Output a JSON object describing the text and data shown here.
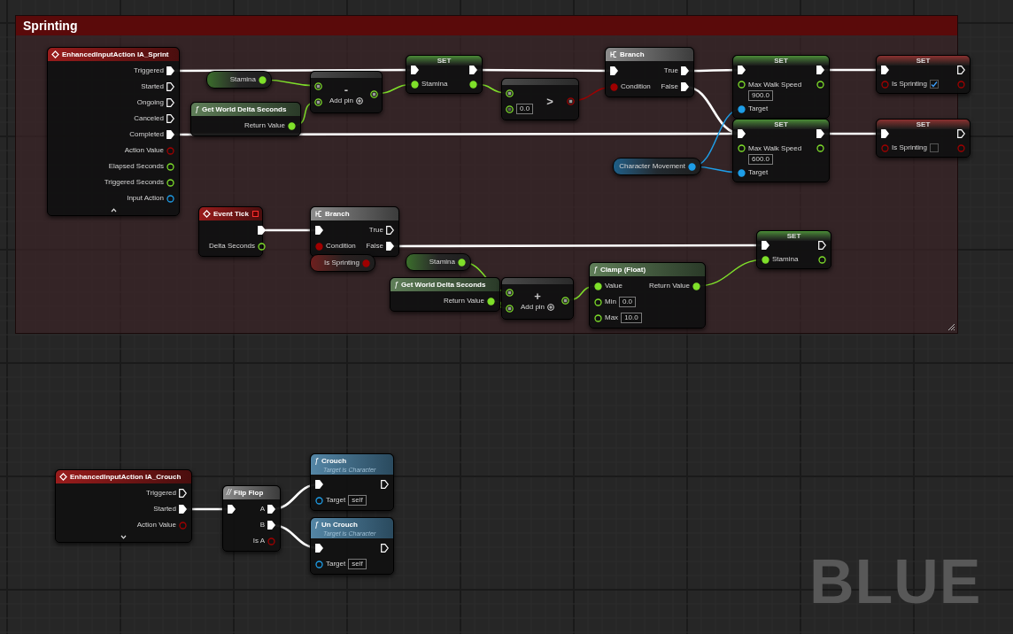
{
  "comment": {
    "title": "Sprinting"
  },
  "nodes": [
    {
      "kind": "event",
      "title": "EnhancedInputAction IA_Sprint",
      "outputs": [
        {
          "label": "Triggered",
          "kind": "exec",
          "linked": true
        },
        {
          "label": "Started",
          "kind": "exec",
          "linked": false
        },
        {
          "label": "Ongoing",
          "kind": "exec",
          "linked": false
        },
        {
          "label": "Canceled",
          "kind": "exec",
          "linked": false
        },
        {
          "label": "Completed",
          "kind": "exec",
          "linked": true
        },
        {
          "label": "Action Value",
          "kind": "bool",
          "linked": false
        },
        {
          "label": "Elapsed Seconds",
          "kind": "float",
          "linked": false
        },
        {
          "label": "Triggered Seconds",
          "kind": "float",
          "linked": false
        },
        {
          "label": "Input Action",
          "kind": "object",
          "linked": false
        }
      ],
      "expanded": true
    },
    {
      "kind": "variable",
      "title": "Stamina",
      "outputs": [
        {
          "kind": "float",
          "linked": true
        }
      ]
    },
    {
      "kind": "pure",
      "glyph": "ƒ",
      "title": "Get World Delta Seconds",
      "outputs": [
        {
          "label": "Return Value",
          "kind": "float",
          "linked": true
        }
      ]
    },
    {
      "kind": "operator",
      "symbol": "-",
      "add_pin": "Add pin",
      "inputs": [
        {
          "kind": "float",
          "linked": true
        },
        {
          "kind": "float",
          "linked": true
        }
      ],
      "outputs": [
        {
          "kind": "float",
          "linked": true
        }
      ]
    },
    {
      "kind": "set",
      "title": "SET",
      "inputs": [
        {
          "kind": "exec",
          "linked": true
        },
        {
          "label": "Stamina",
          "kind": "float",
          "linked": true
        }
      ],
      "outputs": [
        {
          "kind": "exec",
          "linked": true
        },
        {
          "kind": "float",
          "linked": true
        }
      ]
    },
    {
      "kind": "operator",
      "symbol": ">",
      "inputs": [
        {
          "kind": "float",
          "linked": true
        },
        {
          "kind": "float",
          "linked": false,
          "value": "0.0"
        }
      ],
      "outputs": [
        {
          "kind": "bool",
          "linked": true
        }
      ]
    },
    {
      "kind": "branch",
      "title": "Branch",
      "inputs": [
        {
          "kind": "exec",
          "linked": true
        },
        {
          "label": "Condition",
          "kind": "bool",
          "linked": true
        }
      ],
      "outputs": [
        {
          "label": "True",
          "kind": "exec",
          "linked": true
        },
        {
          "label": "False",
          "kind": "exec",
          "linked": true
        }
      ]
    },
    {
      "kind": "set",
      "title": "SET",
      "inputs": [
        {
          "kind": "exec",
          "linked": true
        },
        {
          "label": "Max Walk Speed",
          "kind": "float",
          "linked": false,
          "value": "900.0"
        },
        {
          "label": "Target",
          "kind": "object",
          "linked": true
        }
      ],
      "outputs": [
        {
          "kind": "exec",
          "linked": true
        },
        {
          "kind": "float",
          "linked": false
        }
      ]
    },
    {
      "kind": "set",
      "title": "SET",
      "inputs": [
        {
          "kind": "exec",
          "linked": true
        },
        {
          "label": "Max Walk Speed",
          "kind": "float",
          "linked": false,
          "value": "600.0"
        },
        {
          "label": "Target",
          "kind": "object",
          "linked": true
        }
      ],
      "outputs": [
        {
          "kind": "exec",
          "linked": true
        },
        {
          "kind": "float",
          "linked": false
        }
      ]
    },
    {
      "kind": "variable",
      "title": "Character Movement",
      "outputs": [
        {
          "kind": "object",
          "linked": true
        }
      ]
    },
    {
      "kind": "set",
      "title": "SET",
      "inputs": [
        {
          "kind": "exec",
          "linked": true
        },
        {
          "label": "Is Sprinting",
          "kind": "bool",
          "linked": false,
          "checked": true
        }
      ],
      "outputs": [
        {
          "kind": "exec",
          "linked": false
        },
        {
          "kind": "bool",
          "linked": false
        }
      ]
    },
    {
      "kind": "set",
      "title": "SET",
      "inputs": [
        {
          "kind": "exec",
          "linked": true
        },
        {
          "label": "Is Sprinting",
          "kind": "bool",
          "linked": false,
          "checked": false
        }
      ],
      "outputs": [
        {
          "kind": "exec",
          "linked": false
        },
        {
          "kind": "bool",
          "linked": false
        }
      ]
    },
    {
      "kind": "event",
      "title": "Event Tick",
      "delegate": true,
      "outputs": [
        {
          "kind": "exec",
          "linked": true
        },
        {
          "label": "Delta Seconds",
          "kind": "float",
          "linked": false
        }
      ]
    },
    {
      "kind": "branch",
      "title": "Branch",
      "inputs": [
        {
          "kind": "exec",
          "linked": true
        },
        {
          "label": "Condition",
          "kind": "bool",
          "linked": true
        }
      ],
      "outputs": [
        {
          "label": "True",
          "kind": "exec",
          "linked": false
        },
        {
          "label": "False",
          "kind": "exec",
          "linked": true
        }
      ]
    },
    {
      "kind": "variable",
      "title": "Is Sprinting",
      "outputs": [
        {
          "kind": "bool",
          "linked": true
        }
      ]
    },
    {
      "kind": "variable",
      "title": "Stamina",
      "outputs": [
        {
          "kind": "float",
          "linked": true
        }
      ]
    },
    {
      "kind": "pure",
      "glyph": "ƒ",
      "title": "Get World Delta Seconds",
      "outputs": [
        {
          "label": "Return Value",
          "kind": "float",
          "linked": true
        }
      ]
    },
    {
      "kind": "operator",
      "symbol": "+",
      "add_pin": "Add pin",
      "inputs": [
        {
          "kind": "float",
          "linked": true
        },
        {
          "kind": "float",
          "linked": true
        }
      ],
      "outputs": [
        {
          "kind": "float",
          "linked": true
        }
      ]
    },
    {
      "kind": "pure",
      "glyph": "ƒ",
      "title": "Clamp (Float)",
      "inputs": [
        {
          "label": "Value",
          "kind": "float",
          "linked": true
        },
        {
          "label": "Min",
          "kind": "float",
          "linked": false,
          "value": "0.0"
        },
        {
          "label": "Max",
          "kind": "float",
          "linked": false,
          "value": "10.0"
        }
      ],
      "outputs": [
        {
          "label": "Return Value",
          "kind": "float",
          "linked": true
        }
      ]
    },
    {
      "kind": "set",
      "title": "SET",
      "inputs": [
        {
          "kind": "exec",
          "linked": true
        },
        {
          "label": "Stamina",
          "kind": "float",
          "linked": true
        }
      ],
      "outputs": [
        {
          "kind": "exec",
          "linked": false
        },
        {
          "kind": "float",
          "linked": false
        }
      ]
    },
    {
      "kind": "event",
      "title": "EnhancedInputAction IA_Crouch",
      "outputs": [
        {
          "label": "Triggered",
          "kind": "exec",
          "linked": false
        },
        {
          "label": "Started",
          "kind": "exec",
          "linked": true
        },
        {
          "label": "Action Value",
          "kind": "bool",
          "linked": false
        }
      ],
      "expanded": false
    },
    {
      "kind": "macro",
      "glyph": "//",
      "title": "Flip Flop",
      "inputs": [
        {
          "kind": "exec",
          "linked": true
        }
      ],
      "outputs": [
        {
          "label": "A",
          "kind": "exec",
          "linked": true
        },
        {
          "label": "B",
          "kind": "exec",
          "linked": true
        },
        {
          "label": "Is A",
          "kind": "bool",
          "linked": false
        }
      ]
    },
    {
      "kind": "call",
      "glyph": "ƒ",
      "title": "Crouch",
      "subtitle": "Target is Character",
      "inputs": [
        {
          "kind": "exec",
          "linked": true
        },
        {
          "label": "Target",
          "kind": "object",
          "linked": false,
          "value": "self"
        }
      ],
      "outputs": [
        {
          "kind": "exec",
          "linked": false
        }
      ]
    },
    {
      "kind": "call",
      "glyph": "ƒ",
      "title": "Un Crouch",
      "subtitle": "Target is Character",
      "inputs": [
        {
          "kind": "exec",
          "linked": true
        },
        {
          "label": "Target",
          "kind": "object",
          "linked": false,
          "value": "self"
        }
      ],
      "outputs": [
        {
          "kind": "exec",
          "linked": false
        }
      ]
    }
  ],
  "graph_label": "BLUE"
}
